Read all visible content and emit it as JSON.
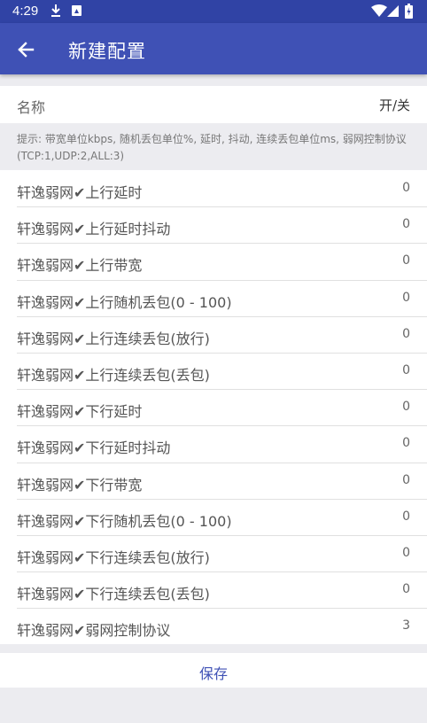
{
  "status_bar": {
    "time": "4:29",
    "icons": [
      "download-icon",
      "sd-card-icon",
      "wifi-icon",
      "cell-signal-icon",
      "battery-icon"
    ]
  },
  "app_bar": {
    "back_icon": "arrow-back-icon",
    "title": "新建配置"
  },
  "name_row": {
    "label": "名称",
    "value": "开/关"
  },
  "hint": "提示: 带宽单位kbps, 随机丢包单位%, 延时, 抖动, 连续丢包单位ms, 弱网控制协议(TCP:1,UDP:2,ALL:3)",
  "settings": [
    {
      "label": "轩逸弱网✔上行延时",
      "value": "0"
    },
    {
      "label": "轩逸弱网✔上行延时抖动",
      "value": "0"
    },
    {
      "label": "轩逸弱网✔上行带宽",
      "value": "0"
    },
    {
      "label": "轩逸弱网✔上行随机丢包(0 - 100)",
      "value": "0"
    },
    {
      "label": "轩逸弱网✔上行连续丢包(放行)",
      "value": "0"
    },
    {
      "label": "轩逸弱网✔上行连续丢包(丢包)",
      "value": "0"
    },
    {
      "label": "轩逸弱网✔下行延时",
      "value": "0"
    },
    {
      "label": "轩逸弱网✔下行延时抖动",
      "value": "0"
    },
    {
      "label": "轩逸弱网✔下行带宽",
      "value": "0"
    },
    {
      "label": "轩逸弱网✔下行随机丢包(0 - 100)",
      "value": "0"
    },
    {
      "label": "轩逸弱网✔下行连续丢包(放行)",
      "value": "0"
    },
    {
      "label": "轩逸弱网✔下行连续丢包(丢包)",
      "value": "0"
    },
    {
      "label": "轩逸弱网✔弱网控制协议",
      "value": "3"
    }
  ],
  "save_label": "保存",
  "colors": {
    "primary": "#3f51b5",
    "primary_dark": "#3043a5",
    "background": "#ececf0"
  }
}
